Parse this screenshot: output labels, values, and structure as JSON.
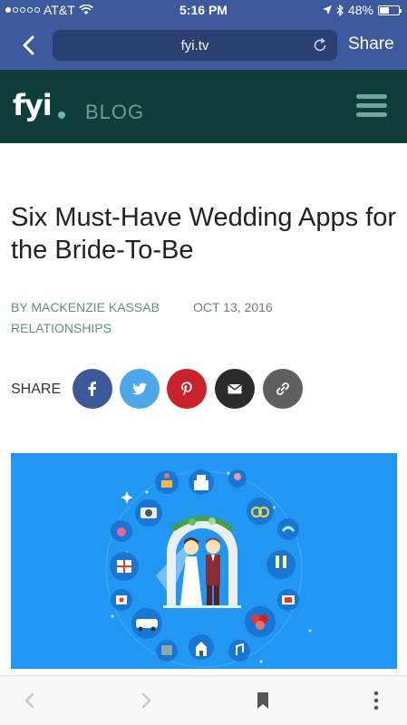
{
  "status_bar": {
    "carrier": "AT&T",
    "time": "5:16 PM",
    "battery": "48%",
    "battery_level": 0.48
  },
  "browser": {
    "url": "fyi.tv",
    "share_label": "Share"
  },
  "site": {
    "logo": "fyi",
    "section": "BLOG"
  },
  "article": {
    "title": "Six Must-Have Wedding Apps for the Bride-To-Be",
    "byline": "BY MACKENZIE KASSAB",
    "date": "OCT 13, 2016",
    "category": "RELATIONSHIPS",
    "share_label": "SHARE"
  },
  "social_buttons": [
    {
      "name": "facebook",
      "glyph": "f",
      "color": "#3b5998"
    },
    {
      "name": "twitter",
      "glyph": "t",
      "color": "#4da7e8"
    },
    {
      "name": "pinterest",
      "glyph": "p",
      "color": "#c8232c"
    },
    {
      "name": "email",
      "glyph": "mail",
      "color": "#2b2b2b"
    },
    {
      "name": "link",
      "glyph": "link",
      "color": "#5f5f5f"
    }
  ],
  "hero": {
    "background": "#2196f3"
  }
}
